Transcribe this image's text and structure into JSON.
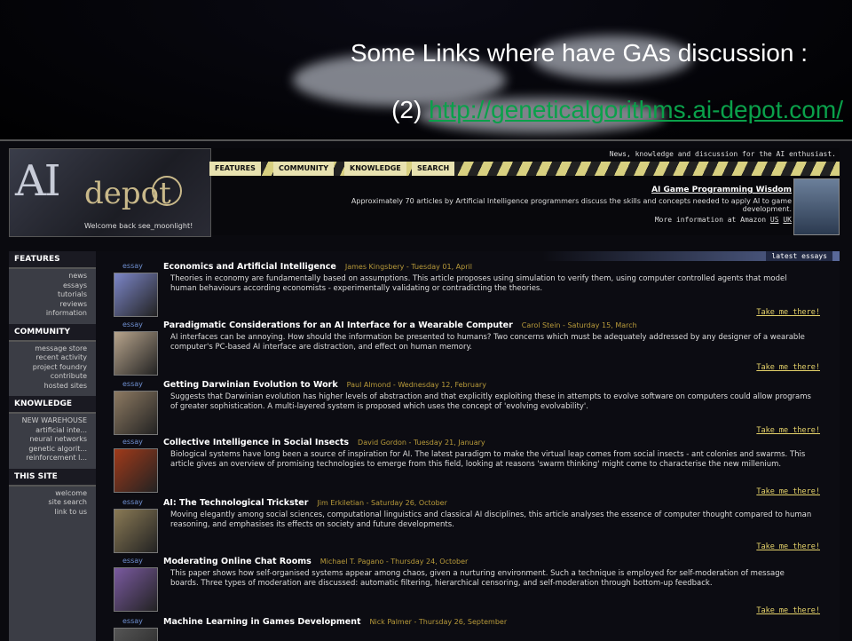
{
  "slide": {
    "title": "Some Links where have GAs discussion :",
    "link_prefix": "(2)",
    "link_text": "http://geneticalgorithms.ai-depot.com/"
  },
  "site": {
    "logo_ai": "AI",
    "logo_depot": "depot",
    "welcome": "Welcome back see_moonlight!",
    "tagline": "News, knowledge and discussion for the AI enthusiast.",
    "nav": [
      "FEATURES",
      "COMMUNITY",
      "KNOWLEDGE",
      "SEARCH"
    ],
    "promo": {
      "title": "AI Game Programming Wisdom",
      "text": "Approximately 70 articles by Artificial Intelligence programmers discuss the skills and concepts needed to apply AI to game development.",
      "more_prefix": "More information at Amazon",
      "us": "US",
      "uk": "UK"
    }
  },
  "sidebar": [
    {
      "heading": "FEATURES",
      "items": [
        "news",
        "essays",
        "tutorials",
        "reviews",
        "information"
      ]
    },
    {
      "heading": "COMMUNITY",
      "items": [
        "message store",
        "recent activity",
        "project foundry",
        "contribute",
        "hosted sites"
      ]
    },
    {
      "heading": "KNOWLEDGE",
      "items": [
        "NEW WAREHOUSE",
        "artificial inte...",
        "neural networks",
        "genetic algorit...",
        "reinforcement l..."
      ]
    },
    {
      "heading": "THIS SITE",
      "items": [
        "welcome",
        "site search",
        "link to us"
      ]
    }
  ],
  "latest_label": "latest essays",
  "essays": [
    {
      "tag": "essay",
      "title": "Economics and Artificial Intelligence",
      "author": "James Kingsbery - Tuesday 01, April",
      "body": "Theories in economy are fundamentally based on assumptions. This article proposes using simulation to verify them, using computer controlled agents that model human behaviours according economists - experimentally validating or contradicting the theories.",
      "more": "Take me there!",
      "thumb": "#7c86c8"
    },
    {
      "tag": "essay",
      "title": "Paradigmatic Considerations for an AI Interface for a Wearable Computer",
      "author": "Carol Stein - Saturday 15, March",
      "body": "AI interfaces can be annoying. How should the information be presented to humans? Two concerns which must be adequately addressed by any designer of a wearable computer's PC-based AI interface are distraction, and effect on human memory.",
      "more": "Take me there!",
      "thumb": "#b7a48c"
    },
    {
      "tag": "essay",
      "title": "Getting Darwinian Evolution to Work",
      "author": "Paul Almond - Wednesday 12, February",
      "body": "Suggests that Darwinian evolution has higher levels of abstraction and that explicitly exploiting these in attempts to evolve software on computers could allow programs of greater sophistication. A multi-layered system is proposed which uses the concept of 'evolving evolvability'.",
      "more": "Take me there!",
      "thumb": "#8d7a62"
    },
    {
      "tag": "essay",
      "title": "Collective Intelligence in Social Insects",
      "author": "David Gordon - Tuesday 21, January",
      "body": "Biological systems have long been a source of inspiration for AI. The latest paradigm to make the virtual leap comes from social insects - ant colonies and swarms. This article gives an overview of promising technologies to emerge from this field, looking at reasons 'swarm thinking' might come to characterise the new millenium.",
      "more": "Take me there!",
      "thumb": "#a03a1a"
    },
    {
      "tag": "essay",
      "title": "AI: The Technological Trickster",
      "author": "Jim Erkiletian - Saturday 26, October",
      "body": "Moving elegantly among social sciences, computational linguistics and classical AI disciplines, this article analyses the essence of computer thought compared to human reasoning, and emphasises its effects on society and future developments.",
      "more": "Take me there!",
      "thumb": "#8a7a55"
    },
    {
      "tag": "essay",
      "title": "Moderating Online Chat Rooms",
      "author": "Michael T. Pagano - Thursday 24, October",
      "body": "This paper shows how self-organised systems appear among chaos, given a nurturing environment. Such a technique is employed for self-moderation of message boards. Three types of moderation are discussed: automatic filtering, hierarchical censoring, and self-moderation through bottom-up feedback.",
      "more": "Take me there!",
      "thumb": "#7a5aa0"
    },
    {
      "tag": "essay",
      "title": "Machine Learning in Games Development",
      "author": "Nick Palmer - Thursday 26, September",
      "body": "",
      "more": "",
      "thumb": "#555"
    }
  ]
}
